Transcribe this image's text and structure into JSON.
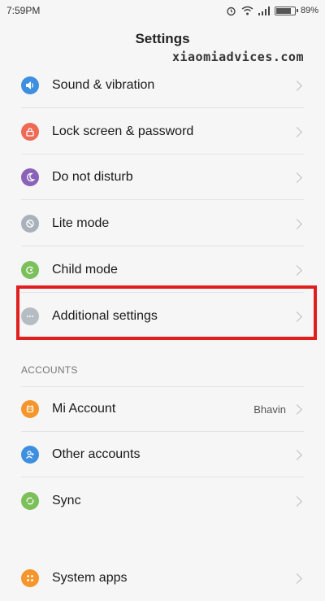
{
  "status_bar": {
    "time": "7:59PM",
    "battery": "89%",
    "battery_level": 0.89
  },
  "header": {
    "title": "Settings"
  },
  "watermark": "xiaomiadvices.com",
  "settings": [
    {
      "label": "Sound & vibration",
      "icon": "speaker-icon",
      "color": "#3f8fe0"
    },
    {
      "label": "Lock screen & password",
      "icon": "lock-icon",
      "color": "#ef6a55"
    },
    {
      "label": "Do not disturb",
      "icon": "moon-icon",
      "color": "#8a63b8"
    },
    {
      "label": "Lite mode",
      "icon": "lite-mode-icon",
      "color": "#a9b2bb"
    },
    {
      "label": "Child mode",
      "icon": "child-mode-icon",
      "color": "#7cc05b"
    },
    {
      "label": "Additional settings",
      "icon": "more-dots-icon",
      "color": "#b6bcc3"
    }
  ],
  "accounts": {
    "header": "ACCOUNTS",
    "items": [
      {
        "label": "Mi Account",
        "value": "Bhavin",
        "icon": "mi-account-icon",
        "color": "#f5962c"
      },
      {
        "label": "Other accounts",
        "icon": "person-add-icon",
        "color": "#3f8fe0"
      },
      {
        "label": "Sync",
        "icon": "sync-icon",
        "color": "#7cc05b"
      }
    ]
  },
  "system": {
    "label": "System apps",
    "icon": "apps-icon",
    "color": "#f5962c"
  },
  "highlight_color": "#e0201f"
}
